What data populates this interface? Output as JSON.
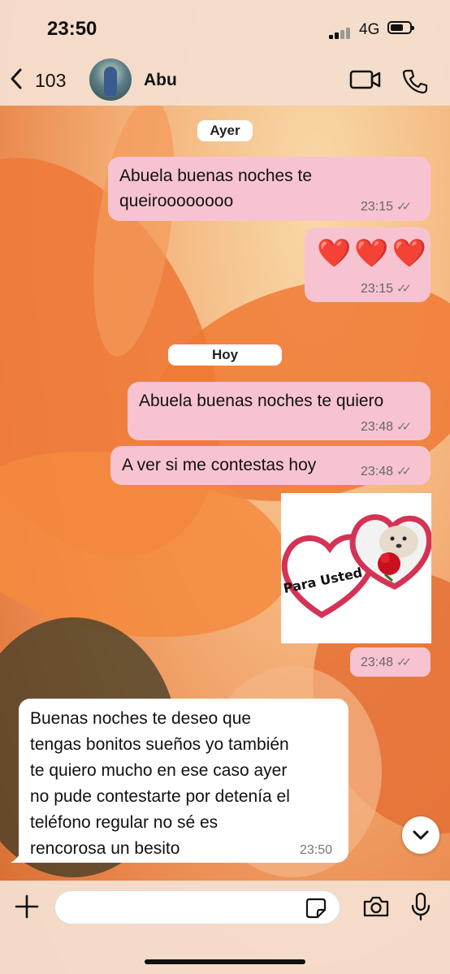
{
  "status_bar": {
    "time": "23:50",
    "network": "4G"
  },
  "header": {
    "back_count": "103",
    "contact_name": "Abu"
  },
  "day_chips": {
    "yesterday": "Ayer",
    "today": "Hoy"
  },
  "messages": [
    {
      "id": "m1",
      "direction": "outgoing",
      "lines": [
        "Abuela buenas noches te",
        "queiroooooooo"
      ],
      "time": "23:15",
      "status": "read"
    },
    {
      "id": "m2",
      "direction": "outgoing",
      "text": "❤️❤️❤️",
      "time": "23:15",
      "status": "read"
    },
    {
      "id": "m3",
      "direction": "outgoing",
      "text": "Abuela buenas noches te quiero",
      "time": "23:48",
      "status": "read"
    },
    {
      "id": "m4",
      "direction": "outgoing",
      "text": "A ver si me contestas hoy",
      "time": "23:48",
      "status": "read"
    },
    {
      "id": "m5",
      "direction": "outgoing",
      "sticker_text": "Para Usted",
      "time": "23:48",
      "status": "read"
    },
    {
      "id": "m6",
      "direction": "incoming",
      "lines": [
        "Buenas noches te deseo que",
        "tengas bonitos sueños yo también",
        "te quiero mucho en ese caso ayer",
        "no pude contestarte por detenía el",
        "teléfono regular no sé es",
        "rencorosa un besito"
      ],
      "time": "23:50"
    }
  ],
  "composer": {
    "placeholder": ""
  },
  "colors": {
    "outgoing_bubble": "#f8c3d1",
    "incoming_bubble": "#ffffff",
    "bar": "#f5decd"
  },
  "icons": [
    "chevron-left-icon",
    "video-camera-icon",
    "phone-icon",
    "plus-icon",
    "sticker-icon",
    "camera-icon",
    "microphone-icon",
    "chevron-down-icon",
    "double-check-icon"
  ]
}
